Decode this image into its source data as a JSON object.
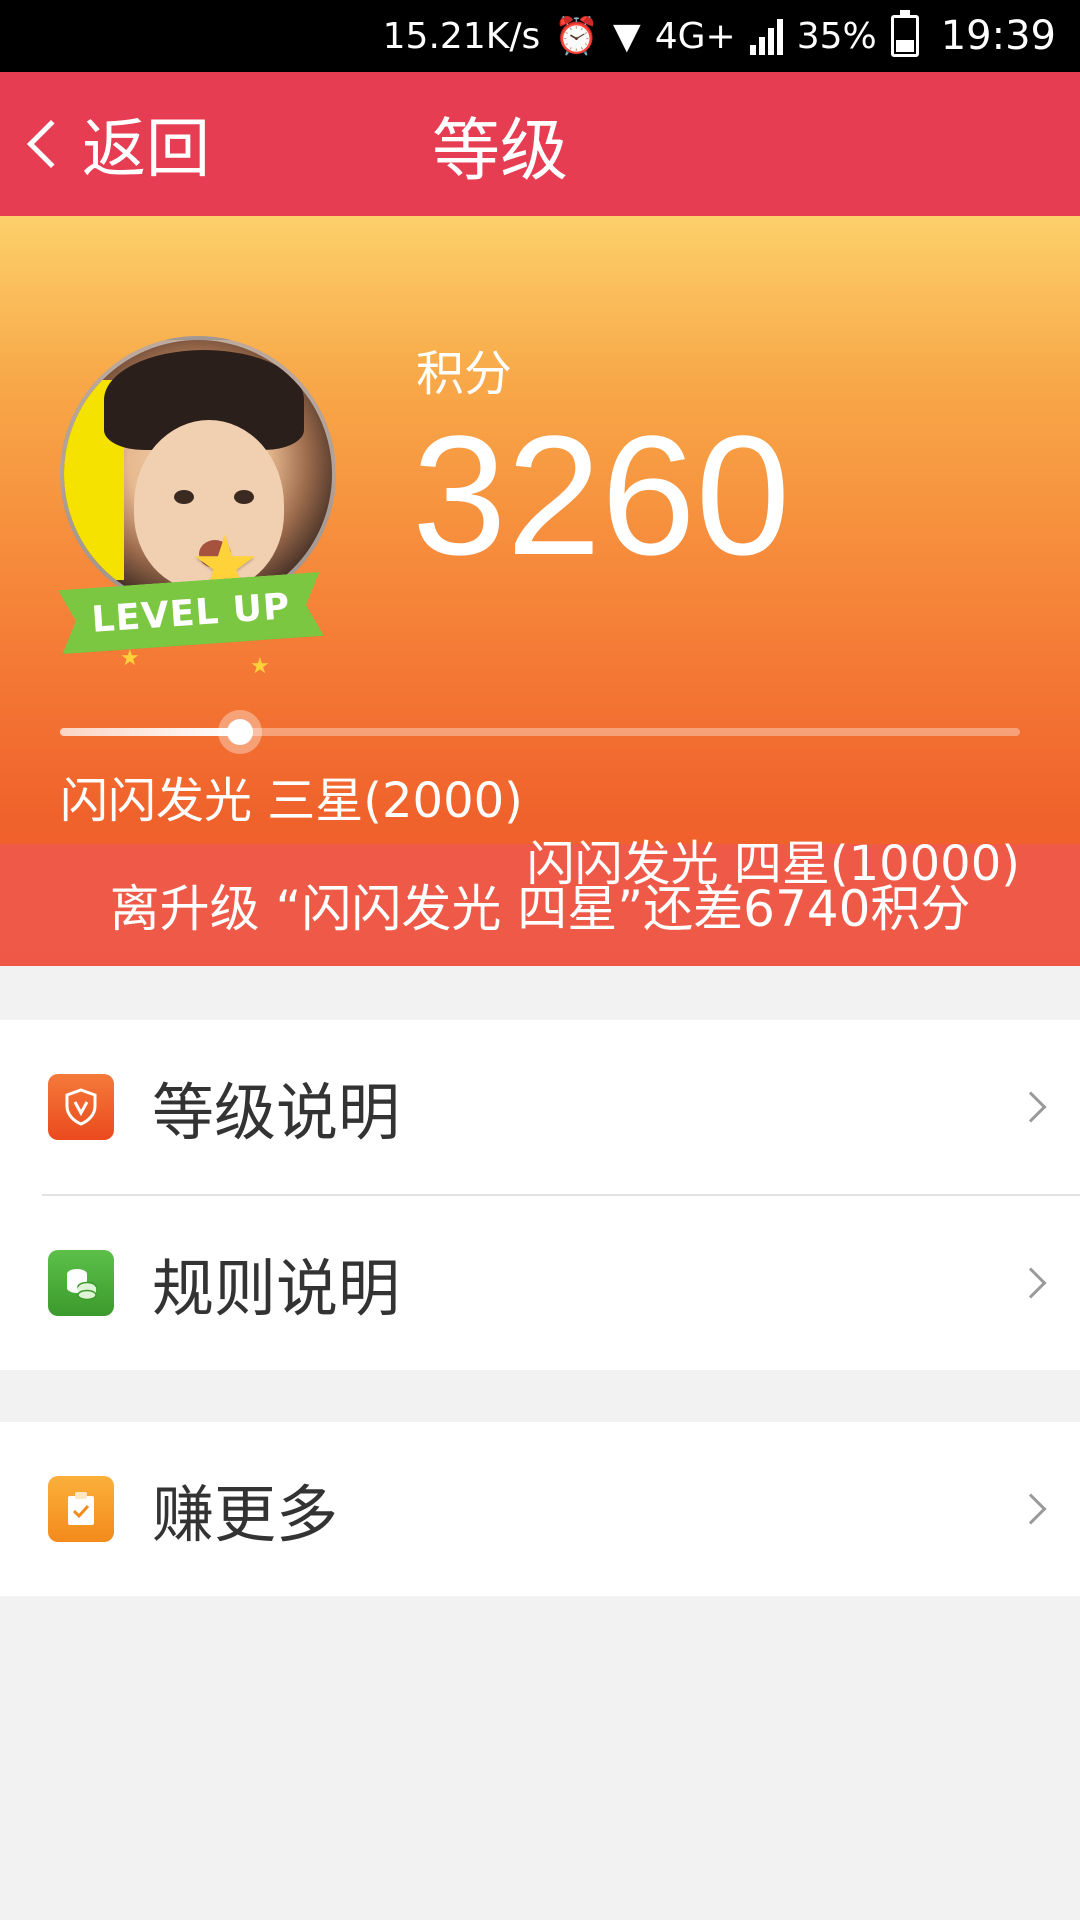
{
  "status_bar": {
    "speed": "15.21K/s",
    "network": "4G+",
    "battery": "35%",
    "time": "19:39"
  },
  "header": {
    "back_label": "返回",
    "title": "等级"
  },
  "profile": {
    "badge_text": "LEVEL UP",
    "points_label": "积分",
    "points_value": "3260"
  },
  "progress": {
    "current_level": "闪闪发光 三星(2000)",
    "next_level": "闪闪发光 四星(10000)",
    "fraction": 0.187,
    "message": "离升级 “闪闪发光 四星”还差6740积分"
  },
  "menu": {
    "group1": [
      {
        "label": "等级说明",
        "icon": "shield-v-icon",
        "color": "#f05a28"
      },
      {
        "label": "规则说明",
        "icon": "coins-icon",
        "color": "#4caf3a"
      }
    ],
    "group2": [
      {
        "label": "赚更多",
        "icon": "clipboard-check-icon",
        "color": "#f59a23"
      }
    ]
  },
  "colors": {
    "header": "#e63d52",
    "hero_top": "#fcd06b",
    "hero_bottom": "#ee5b2b"
  }
}
